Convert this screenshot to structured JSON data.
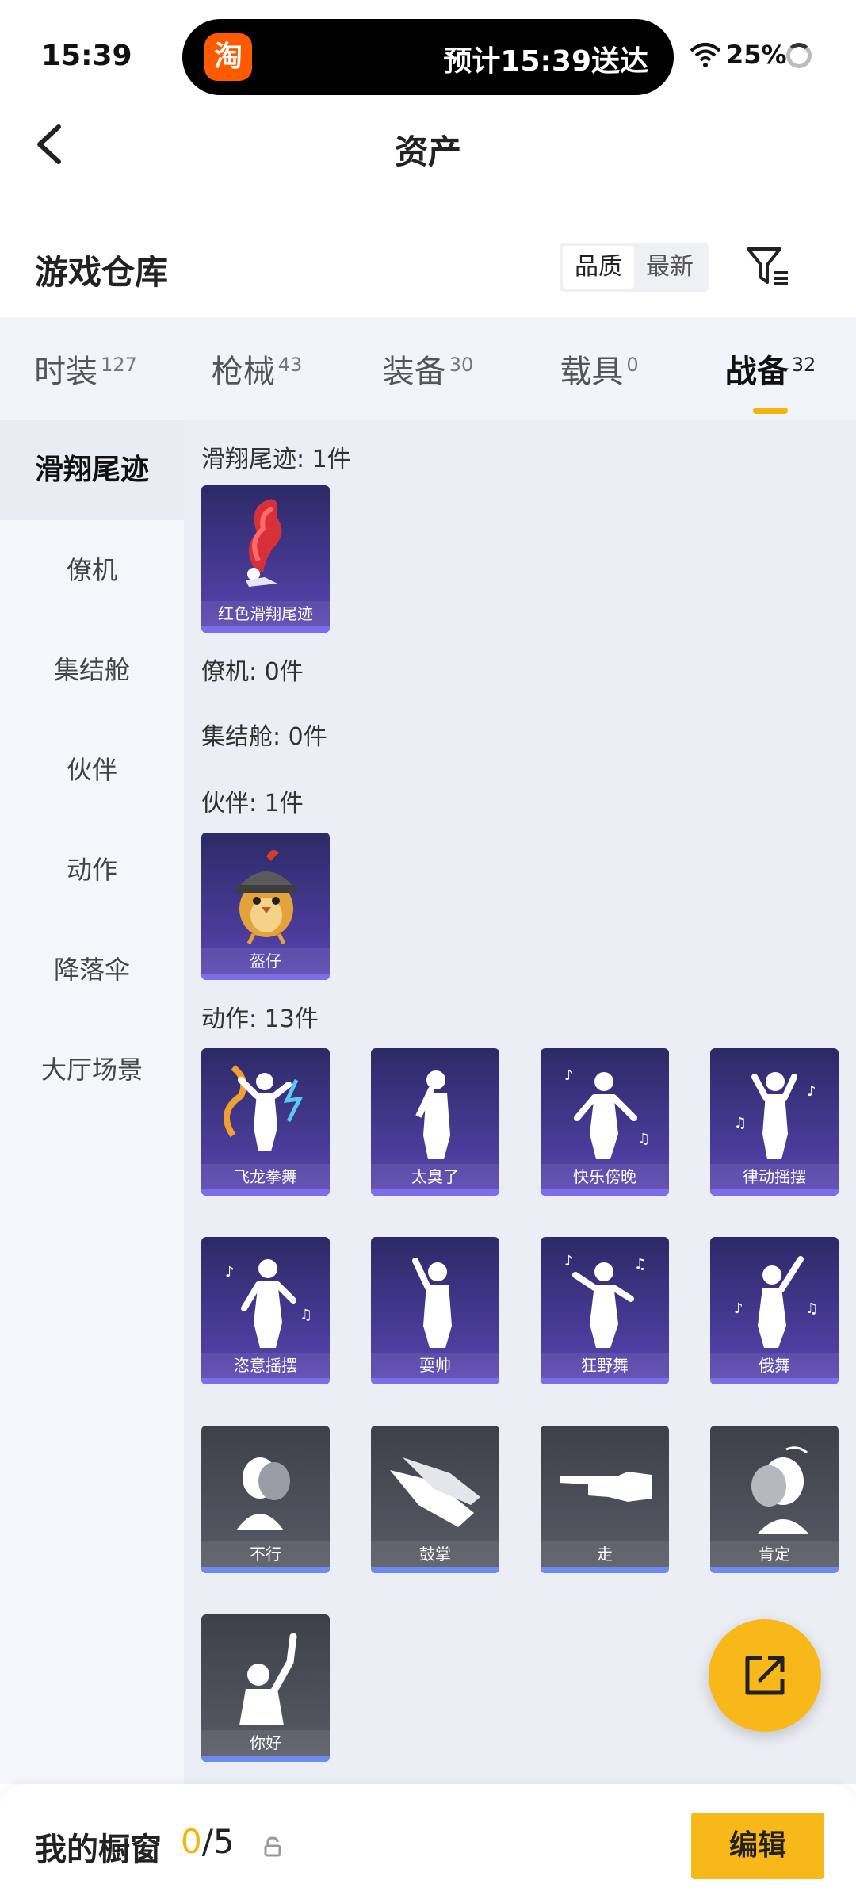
{
  "status": {
    "time": "15:39",
    "app_badge": "淘",
    "eta": "预计15:39送达",
    "battery": "25%"
  },
  "header": {
    "title": "资产"
  },
  "warehouse": {
    "title": "游戏仓库",
    "sort_options": [
      "品质",
      "最新"
    ],
    "sort_selected": "品质"
  },
  "tabs": [
    {
      "label": "时装",
      "count": "127"
    },
    {
      "label": "枪械",
      "count": "43"
    },
    {
      "label": "装备",
      "count": "30"
    },
    {
      "label": "载具",
      "count": "0"
    },
    {
      "label": "战备",
      "count": "32",
      "active": true
    }
  ],
  "sidebar": {
    "items": [
      "滑翔尾迹",
      "僚机",
      "集结舱",
      "伙伴",
      "动作",
      "降落伞",
      "大厅场景"
    ],
    "active": "滑翔尾迹"
  },
  "sections": {
    "glide_trail": {
      "label": "滑翔尾迹: 1件",
      "items": [
        "红色滑翔尾迹"
      ]
    },
    "wingman": {
      "label": "僚机: 0件"
    },
    "rally_pod": {
      "label": "集结舱: 0件"
    },
    "partner": {
      "label": "伙伴: 1件",
      "items": [
        "盔仔"
      ]
    },
    "emotes": {
      "label": "动作: 13件",
      "items": [
        "飞龙拳舞",
        "太臭了",
        "快乐傍晚",
        "律动摇摆",
        "恣意摇摆",
        "耍帅",
        "狂野舞",
        "俄舞",
        "不行",
        "鼓掌",
        "走",
        "肯定",
        "你好"
      ]
    }
  },
  "bottom": {
    "label": "我的橱窗",
    "count_used": "0",
    "count_total": "/5",
    "edit_label": "编辑"
  },
  "colors": {
    "accent": "#f9b81a",
    "card_purple": "#3b3383",
    "card_gray": "#4a4d56"
  }
}
